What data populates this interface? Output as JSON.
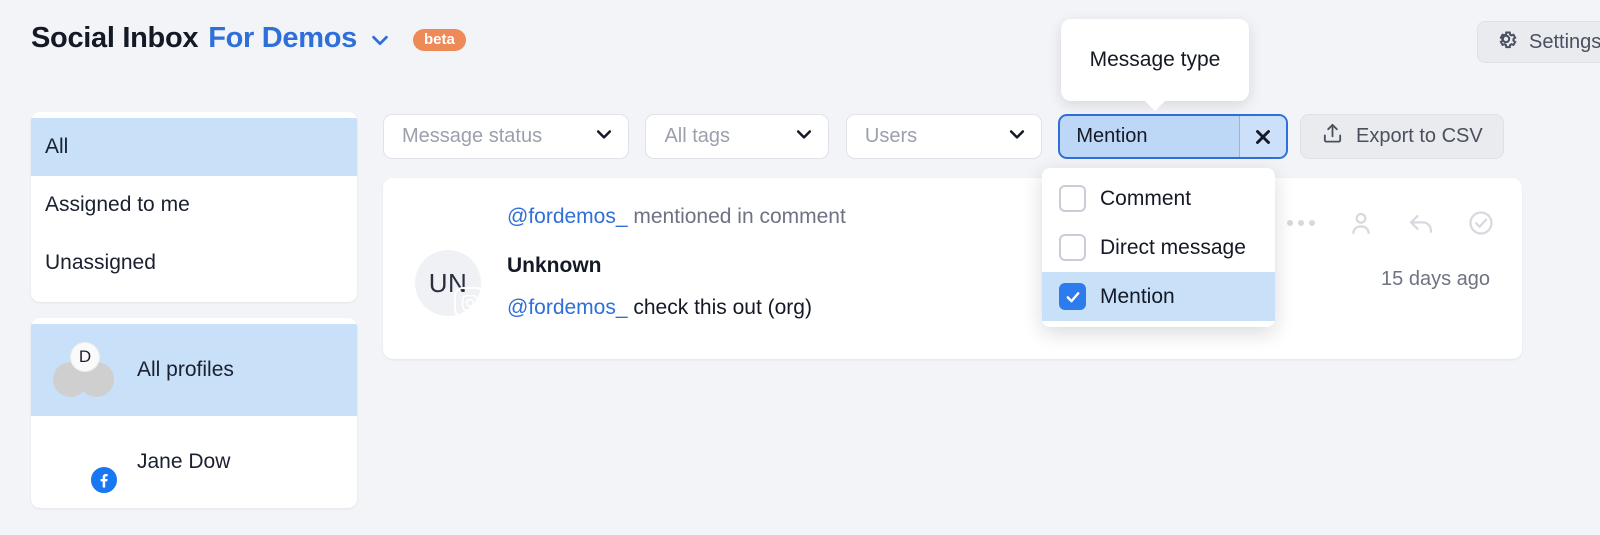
{
  "header": {
    "title_main": "Social Inbox",
    "title_sub": "For Demos",
    "beta_badge": "beta",
    "settings_label": "Settings",
    "chevron_icon": "chevron-down-icon",
    "gear_icon": "gear-icon"
  },
  "sidebar": {
    "filters": [
      {
        "label": "All",
        "selected": true
      },
      {
        "label": "Assigned to me",
        "selected": false
      },
      {
        "label": "Unassigned",
        "selected": false
      }
    ],
    "profiles": [
      {
        "label": "All profiles",
        "selected": true,
        "badge_letter": "D",
        "network": ""
      },
      {
        "label": "Jane Dow",
        "selected": false,
        "badge_letter": "",
        "network": "facebook"
      }
    ]
  },
  "filterbar": {
    "chips": [
      {
        "label": "Message status",
        "active": false
      },
      {
        "label": "All tags",
        "active": false
      },
      {
        "label": "Users",
        "active": false
      }
    ],
    "active_chip": {
      "label": "Mention",
      "clear_icon": "close-icon"
    },
    "export_label": "Export to CSV",
    "export_icon": "export-upload-icon"
  },
  "tooltip": {
    "text": "Message type"
  },
  "dropdown": {
    "options": [
      {
        "label": "Comment",
        "checked": false
      },
      {
        "label": "Direct message",
        "checked": false
      },
      {
        "label": "Mention",
        "checked": true
      }
    ]
  },
  "message": {
    "head_mention": "@fordemos_",
    "head_rest": " mentioned in comment",
    "avatar_initials": "UN",
    "network": "instagram",
    "sender": "Unknown",
    "body_mention": "@fordemos_",
    "body_rest": " check this out (org)",
    "time_ago": "15 days ago",
    "actions": [
      "more-icon",
      "assign-user-icon",
      "reply-icon",
      "mark-done-icon"
    ]
  },
  "colors": {
    "accent_blue": "#2E6FD9",
    "selected_row": "#C8E0F8",
    "beta_orange": "#ED8A58",
    "page_bg": "#F2F4F7",
    "checkbox_on": "#2E7BEE"
  }
}
